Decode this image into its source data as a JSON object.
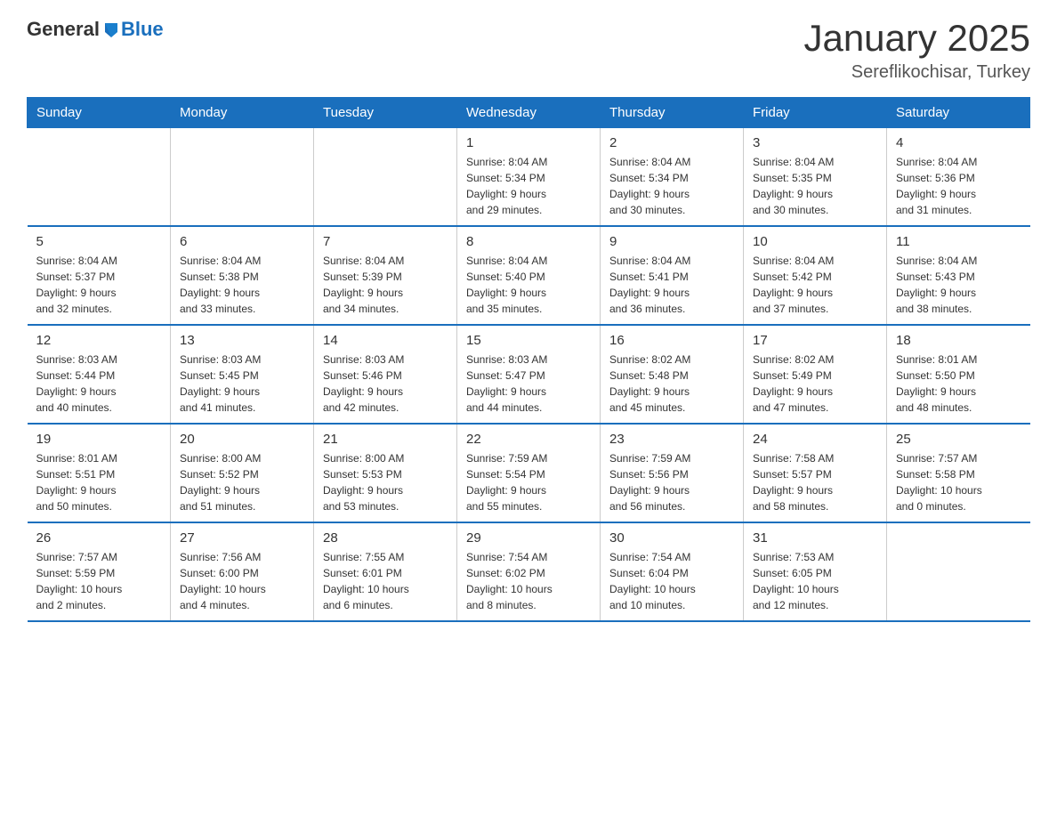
{
  "logo": {
    "text_general": "General",
    "text_blue": "Blue"
  },
  "header": {
    "title": "January 2025",
    "subtitle": "Sereflikochisar, Turkey"
  },
  "days_of_week": [
    "Sunday",
    "Monday",
    "Tuesday",
    "Wednesday",
    "Thursday",
    "Friday",
    "Saturday"
  ],
  "weeks": [
    [
      {
        "day": "",
        "info": ""
      },
      {
        "day": "",
        "info": ""
      },
      {
        "day": "",
        "info": ""
      },
      {
        "day": "1",
        "info": "Sunrise: 8:04 AM\nSunset: 5:34 PM\nDaylight: 9 hours\nand 29 minutes."
      },
      {
        "day": "2",
        "info": "Sunrise: 8:04 AM\nSunset: 5:34 PM\nDaylight: 9 hours\nand 30 minutes."
      },
      {
        "day": "3",
        "info": "Sunrise: 8:04 AM\nSunset: 5:35 PM\nDaylight: 9 hours\nand 30 minutes."
      },
      {
        "day": "4",
        "info": "Sunrise: 8:04 AM\nSunset: 5:36 PM\nDaylight: 9 hours\nand 31 minutes."
      }
    ],
    [
      {
        "day": "5",
        "info": "Sunrise: 8:04 AM\nSunset: 5:37 PM\nDaylight: 9 hours\nand 32 minutes."
      },
      {
        "day": "6",
        "info": "Sunrise: 8:04 AM\nSunset: 5:38 PM\nDaylight: 9 hours\nand 33 minutes."
      },
      {
        "day": "7",
        "info": "Sunrise: 8:04 AM\nSunset: 5:39 PM\nDaylight: 9 hours\nand 34 minutes."
      },
      {
        "day": "8",
        "info": "Sunrise: 8:04 AM\nSunset: 5:40 PM\nDaylight: 9 hours\nand 35 minutes."
      },
      {
        "day": "9",
        "info": "Sunrise: 8:04 AM\nSunset: 5:41 PM\nDaylight: 9 hours\nand 36 minutes."
      },
      {
        "day": "10",
        "info": "Sunrise: 8:04 AM\nSunset: 5:42 PM\nDaylight: 9 hours\nand 37 minutes."
      },
      {
        "day": "11",
        "info": "Sunrise: 8:04 AM\nSunset: 5:43 PM\nDaylight: 9 hours\nand 38 minutes."
      }
    ],
    [
      {
        "day": "12",
        "info": "Sunrise: 8:03 AM\nSunset: 5:44 PM\nDaylight: 9 hours\nand 40 minutes."
      },
      {
        "day": "13",
        "info": "Sunrise: 8:03 AM\nSunset: 5:45 PM\nDaylight: 9 hours\nand 41 minutes."
      },
      {
        "day": "14",
        "info": "Sunrise: 8:03 AM\nSunset: 5:46 PM\nDaylight: 9 hours\nand 42 minutes."
      },
      {
        "day": "15",
        "info": "Sunrise: 8:03 AM\nSunset: 5:47 PM\nDaylight: 9 hours\nand 44 minutes."
      },
      {
        "day": "16",
        "info": "Sunrise: 8:02 AM\nSunset: 5:48 PM\nDaylight: 9 hours\nand 45 minutes."
      },
      {
        "day": "17",
        "info": "Sunrise: 8:02 AM\nSunset: 5:49 PM\nDaylight: 9 hours\nand 47 minutes."
      },
      {
        "day": "18",
        "info": "Sunrise: 8:01 AM\nSunset: 5:50 PM\nDaylight: 9 hours\nand 48 minutes."
      }
    ],
    [
      {
        "day": "19",
        "info": "Sunrise: 8:01 AM\nSunset: 5:51 PM\nDaylight: 9 hours\nand 50 minutes."
      },
      {
        "day": "20",
        "info": "Sunrise: 8:00 AM\nSunset: 5:52 PM\nDaylight: 9 hours\nand 51 minutes."
      },
      {
        "day": "21",
        "info": "Sunrise: 8:00 AM\nSunset: 5:53 PM\nDaylight: 9 hours\nand 53 minutes."
      },
      {
        "day": "22",
        "info": "Sunrise: 7:59 AM\nSunset: 5:54 PM\nDaylight: 9 hours\nand 55 minutes."
      },
      {
        "day": "23",
        "info": "Sunrise: 7:59 AM\nSunset: 5:56 PM\nDaylight: 9 hours\nand 56 minutes."
      },
      {
        "day": "24",
        "info": "Sunrise: 7:58 AM\nSunset: 5:57 PM\nDaylight: 9 hours\nand 58 minutes."
      },
      {
        "day": "25",
        "info": "Sunrise: 7:57 AM\nSunset: 5:58 PM\nDaylight: 10 hours\nand 0 minutes."
      }
    ],
    [
      {
        "day": "26",
        "info": "Sunrise: 7:57 AM\nSunset: 5:59 PM\nDaylight: 10 hours\nand 2 minutes."
      },
      {
        "day": "27",
        "info": "Sunrise: 7:56 AM\nSunset: 6:00 PM\nDaylight: 10 hours\nand 4 minutes."
      },
      {
        "day": "28",
        "info": "Sunrise: 7:55 AM\nSunset: 6:01 PM\nDaylight: 10 hours\nand 6 minutes."
      },
      {
        "day": "29",
        "info": "Sunrise: 7:54 AM\nSunset: 6:02 PM\nDaylight: 10 hours\nand 8 minutes."
      },
      {
        "day": "30",
        "info": "Sunrise: 7:54 AM\nSunset: 6:04 PM\nDaylight: 10 hours\nand 10 minutes."
      },
      {
        "day": "31",
        "info": "Sunrise: 7:53 AM\nSunset: 6:05 PM\nDaylight: 10 hours\nand 12 minutes."
      },
      {
        "day": "",
        "info": ""
      }
    ]
  ]
}
